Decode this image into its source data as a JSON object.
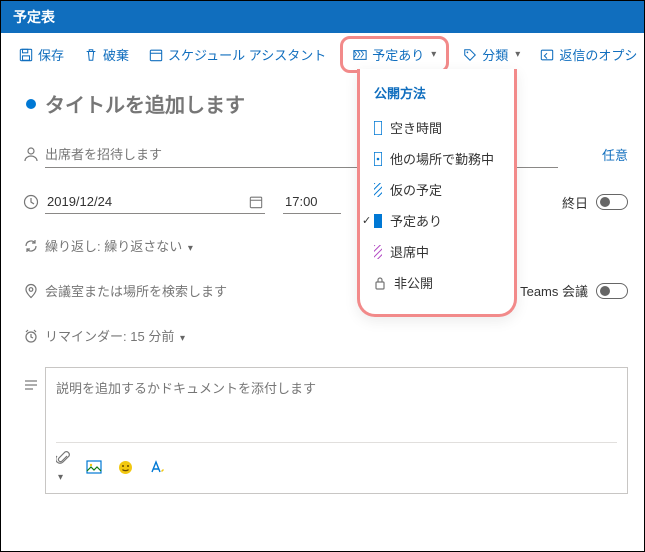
{
  "window": {
    "title": "予定表"
  },
  "toolbar": {
    "save": "保存",
    "discard": "破棄",
    "scheduling": "スケジュール アシスタント",
    "show_as": "予定あり",
    "categorize": "分類",
    "reply_options": "返信のオプシ"
  },
  "form": {
    "title_placeholder": "タイトルを追加します",
    "attendees_placeholder": "出席者を招待します",
    "optional_label": "任意",
    "date": "2019/12/24",
    "start_time": "17:00",
    "all_day_label": "終日",
    "repeat_label": "繰り返し:",
    "repeat_value": "繰り返さない",
    "location_placeholder": "会議室または場所を検索します",
    "teams_label": "Teams 会議",
    "reminder_label": "リマインダー:",
    "reminder_value": "15 分前",
    "description_placeholder": "説明を追加するかドキュメントを添付します"
  },
  "dropdown": {
    "section": "公開方法",
    "items": [
      {
        "label": "空き時間"
      },
      {
        "label": "他の場所で勤務中"
      },
      {
        "label": "仮の予定"
      },
      {
        "label": "予定あり",
        "selected": true
      },
      {
        "label": "退席中"
      },
      {
        "label": "非公開"
      }
    ]
  }
}
